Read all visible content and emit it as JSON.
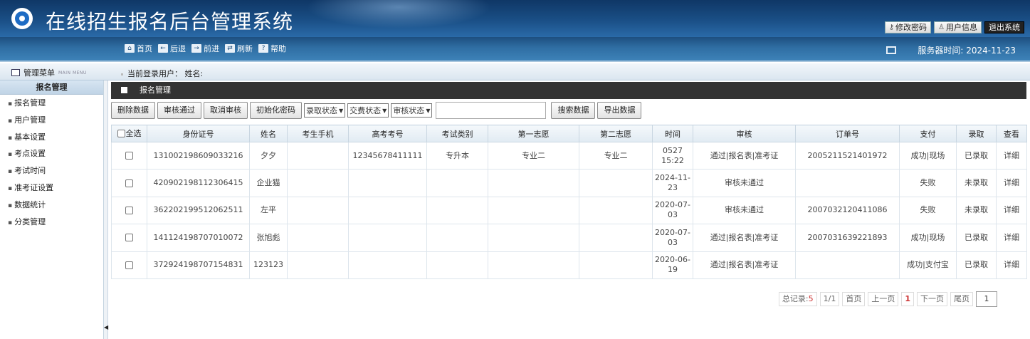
{
  "app": {
    "title": "在线招生报名后台管理系统"
  },
  "header_links": [
    {
      "icon": "key-icon",
      "label": "修改密码"
    },
    {
      "icon": "user-icon",
      "label": "用户信息"
    },
    {
      "icon": "",
      "label": "退出系统"
    }
  ],
  "nav": [
    {
      "icon": "home-icon",
      "glyph": "⌂",
      "label": "首页"
    },
    {
      "icon": "back-icon",
      "glyph": "←",
      "label": "后退"
    },
    {
      "icon": "forward-icon",
      "glyph": "→",
      "label": "前进"
    },
    {
      "icon": "refresh-icon",
      "glyph": "⇄",
      "label": "刷新"
    },
    {
      "icon": "help-icon",
      "glyph": "?",
      "label": "帮助"
    }
  ],
  "server_time": "服务器时间: 2024-11-23",
  "menu": {
    "title": "管理菜单",
    "subtitle": "MAIN MENU"
  },
  "login_user": "当前登录用户： 姓名:",
  "sidebar": {
    "header": "报名管理",
    "items": [
      "报名管理",
      "用户管理",
      "基本设置",
      "考点设置",
      "考试时间",
      "准考证设置",
      "数据统计",
      "分类管理"
    ]
  },
  "panel_title": "报名管理",
  "toolbar": {
    "delete": "删除数据",
    "approve": "审核通过",
    "cancel_approve": "取消审核",
    "reset_password": "初始化密码",
    "admit_status": "录取状态",
    "pay_status": "交费状态",
    "review_status": "审核状态",
    "search_value": "",
    "search": "搜索数据",
    "export": "导出数据"
  },
  "table": {
    "select_all": "全选",
    "columns": [
      "身份证号",
      "姓名",
      "考生手机",
      "高考考号",
      "考试类别",
      "第一志愿",
      "第二志愿",
      "时间",
      "审核",
      "订单号",
      "支付",
      "录取",
      "查看"
    ],
    "rows": [
      {
        "id": "131002198609033216",
        "name": "夕夕",
        "phone": "",
        "exam_no": "12345678411111",
        "category": "专升本",
        "first": "专业二",
        "second": "专业二",
        "time": "0527 15:22",
        "review": "通过|报名表|准考证",
        "review_ok": true,
        "order": "2005211521401972",
        "pay": "成功|现场",
        "pay_ok": true,
        "admit": "已录取",
        "admit_ok": true,
        "view": "详细"
      },
      {
        "id": "420902198112306415",
        "name": "企业猫",
        "phone": "",
        "exam_no": "",
        "category": "",
        "first": "",
        "second": "",
        "time": "2024-11-23",
        "review": "审核未通过",
        "review_ok": false,
        "order": "",
        "pay": "失败",
        "pay_ok": false,
        "admit": "未录取",
        "admit_ok": false,
        "view": "详细"
      },
      {
        "id": "362202199512062511",
        "name": "左平",
        "phone": "",
        "exam_no": "",
        "category": "",
        "first": "",
        "second": "",
        "time": "2020-07-03",
        "review": "审核未通过",
        "review_ok": false,
        "order": "2007032120411086",
        "pay": "失败",
        "pay_ok": false,
        "admit": "未录取",
        "admit_ok": false,
        "view": "详细"
      },
      {
        "id": "141124198707010072",
        "name": "张旭彪",
        "phone": "",
        "exam_no": "",
        "category": "",
        "first": "",
        "second": "",
        "time": "2020-07-03",
        "review": "通过|报名表|准考证",
        "review_ok": true,
        "order": "2007031639221893",
        "pay": "成功|现场",
        "pay_ok": true,
        "admit": "已录取",
        "admit_ok": true,
        "view": "详细"
      },
      {
        "id": "372924198707154831",
        "name": "123123",
        "phone": "",
        "exam_no": "",
        "category": "",
        "first": "",
        "second": "",
        "time": "2020-06-19",
        "review": "通过|报名表|准考证",
        "review_ok": true,
        "order": "",
        "pay": "成功|支付宝",
        "pay_ok": true,
        "admit": "已录取",
        "admit_ok": true,
        "view": "详细"
      }
    ]
  },
  "pagination": {
    "total_label": "总记录:",
    "total": "5",
    "pages": "1/1",
    "first": "首页",
    "prev": "上一页",
    "current": "1",
    "next": "下一页",
    "last": "尾页",
    "input": "1"
  }
}
